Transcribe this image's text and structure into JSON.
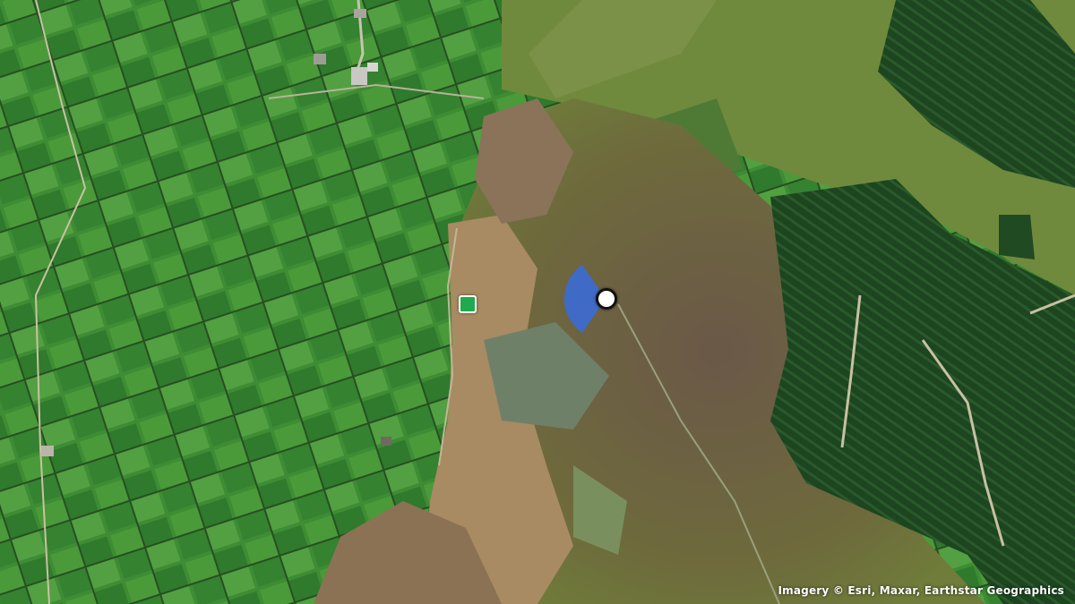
{
  "map": {
    "imagery_type": "satellite",
    "attribution": "Imagery © Esri, Maxar, Earthstar Geographics",
    "colors": {
      "field_green": "#3f8f36",
      "moorland": "#7a6a3e",
      "heather": "#6e5a48",
      "forest": "#1f4a22",
      "heading_cone": "#3a6bd6",
      "destination": "#1faa4f"
    }
  },
  "markers": {
    "user_location": {
      "icon": "user-location-dot-icon"
    },
    "heading_cone": {
      "icon": "heading-cone-icon"
    },
    "destination": {
      "icon": "destination-square-icon"
    }
  }
}
